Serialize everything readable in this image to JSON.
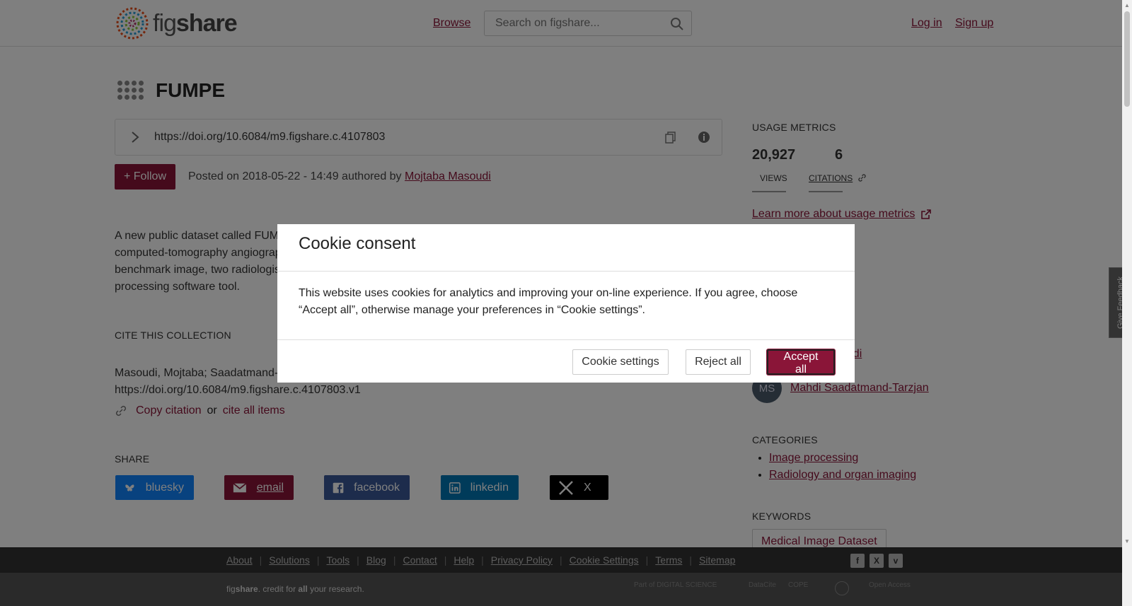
{
  "header": {
    "logo_fig": "fig",
    "logo_share": "share",
    "browse": "Browse",
    "search_placeholder": "Search on figshare...",
    "login": "Log in",
    "signup": "Sign up"
  },
  "page": {
    "title": "FUMPE",
    "doi": "https://doi.org/10.6084/m9.figshare.c.4107803",
    "follow_label": "+ Follow",
    "posted_prefix": "Posted on 2018-05-22 - 14:49 authored by ",
    "posted_author": "Mojtaba Masoudi",
    "description_lines": [
      "A new public dataset called FUM",
      "computed-tomography angiograp",
      "benchmark image, two radiologis",
      "processing software tool."
    ],
    "cite_heading": "CITE THIS COLLECTION",
    "cite_line1": "Masoudi, Mojtaba; Saadatmand-",
    "cite_line2": "https://doi.org/10.6084/m9.figshare.c.4107803.v1",
    "copy_citation": "Copy citation",
    "or": "or",
    "cite_all": "cite all items",
    "share_heading": "SHARE",
    "share": {
      "bluesky": "bluesky",
      "email": "email",
      "facebook": "facebook",
      "linkedin": "linkedin",
      "x": "X"
    }
  },
  "sidebar": {
    "usage_heading": "USAGE METRICS",
    "views_num": "20,927",
    "views_label": "VIEWS",
    "citations_num": "6",
    "citations_label": "CITATIONS",
    "learn_more": "Learn more about usage metrics",
    "author1_partial": "oudi",
    "author2_initials": "MS",
    "author2_name": "Mahdi Saadatmand-Tarzjan",
    "categories_heading": "CATEGORIES",
    "categories": [
      "Image processing",
      "Radiology and organ imaging"
    ],
    "keywords_heading": "KEYWORDS",
    "keyword1": "Medical Image Dataset"
  },
  "feedback": "Give Feedback",
  "cookie_modal": {
    "title": "Cookie consent",
    "body": "This website uses cookies for analytics and improving your on-line experience. If you agree, choose “Accept all”, otherwise manage your preferences in “Cookie settings”.",
    "settings": "Cookie settings",
    "reject": "Reject all",
    "accept": "Accept all"
  },
  "footer": {
    "links": [
      "About",
      "Solutions",
      "Tools",
      "Blog",
      "Contact",
      "Help",
      "Privacy Policy",
      "Cookie Settings",
      "Terms",
      "Sitemap"
    ],
    "tagline_fig": "fig",
    "tagline_share": "share",
    "tagline_mid": ". credit for ",
    "tagline_all": "all",
    "tagline_end": " your research.",
    "partners": [
      "Part of DIGITAL SCIENCE",
      "DataCite",
      "COPE",
      "",
      "Open Access"
    ]
  },
  "colors": {
    "brand": "#8a1538",
    "bluesky": "#1185fe",
    "facebook": "#3b5998",
    "linkedin": "#0077b5",
    "x": "#000000"
  }
}
